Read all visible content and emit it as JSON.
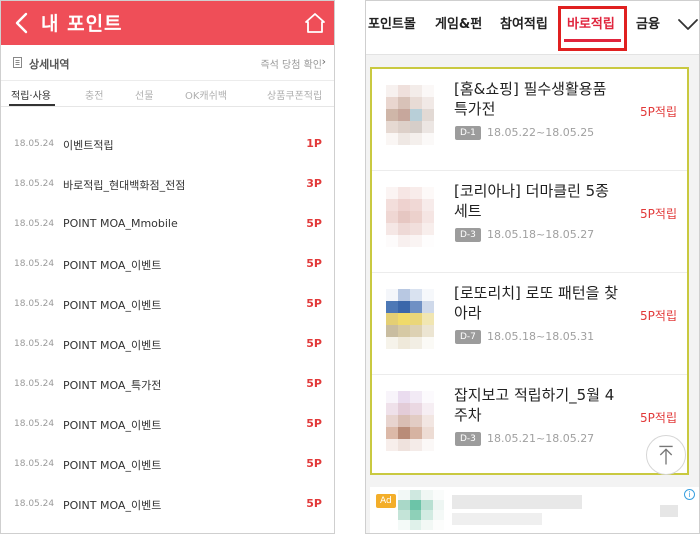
{
  "left_panel": {
    "header": {
      "title": "내 포인트",
      "back_icon": "chevron-left-icon",
      "home_icon": "home-icon",
      "color": "#ef4e58"
    },
    "subbar": {
      "detail_label": "상세내역",
      "instant_check_label": "즉석 당첨 확인"
    },
    "tabs": [
      {
        "label": "적립·사용",
        "active": true
      },
      {
        "label": "충전",
        "active": false
      },
      {
        "label": "선물",
        "active": false
      },
      {
        "label": "OK캐쉬백",
        "active": false
      },
      {
        "label": "상품쿠폰적립",
        "active": false
      }
    ],
    "transactions": [
      {
        "date": "18.05.24",
        "name": "이벤트적립",
        "points": "1P"
      },
      {
        "date": "18.05.24",
        "name": "바로적립_현대백화점_전점",
        "points": "3P"
      },
      {
        "date": "18.05.24",
        "name": "POINT MOA_Mmobile",
        "points": "5P"
      },
      {
        "date": "18.05.24",
        "name": "POINT MOA_이벤트",
        "points": "5P"
      },
      {
        "date": "18.05.24",
        "name": "POINT MOA_이벤트",
        "points": "5P"
      },
      {
        "date": "18.05.24",
        "name": "POINT MOA_이벤트",
        "points": "5P"
      },
      {
        "date": "18.05.24",
        "name": "POINT MOA_특가전",
        "points": "5P"
      },
      {
        "date": "18.05.24",
        "name": "POINT MOA_이벤트",
        "points": "5P"
      },
      {
        "date": "18.05.24",
        "name": "POINT MOA_이벤트",
        "points": "5P"
      },
      {
        "date": "18.05.24",
        "name": "POINT MOA_이벤트",
        "points": "5P"
      }
    ]
  },
  "right_panel": {
    "nav_tabs": [
      {
        "label": "포인트몰",
        "active": false
      },
      {
        "label": "게임&펀",
        "active": false
      },
      {
        "label": "참여적립",
        "active": false
      },
      {
        "label": "바로적립",
        "active": true
      },
      {
        "label": "금융",
        "active": false
      }
    ],
    "expand_icon": "chevron-down-icon",
    "accent_color": "#e0243c",
    "deals": [
      {
        "title": "[홈&쇼핑] 필수생활용품 특가전",
        "dday": "D-1",
        "period": "18.05.22~18.05.25",
        "points": "5P적립"
      },
      {
        "title": "[코리아나] 더마클린 5종 세트",
        "dday": "D-3",
        "period": "18.05.18~18.05.27",
        "points": "5P적립"
      },
      {
        "title": "[로또리치] 로또 패턴을 찾아라",
        "dday": "D-7",
        "period": "18.05.18~18.05.31",
        "points": "5P적립"
      },
      {
        "title": "잡지보고 적립하기_5월 4주차",
        "dday": "D-3",
        "period": "18.05.21~18.05.27",
        "points": "5P적립"
      }
    ],
    "scroll_top_icon": "arrow-up-icon",
    "ad": {
      "badge": "Ad",
      "info_icon": "info-icon"
    }
  }
}
